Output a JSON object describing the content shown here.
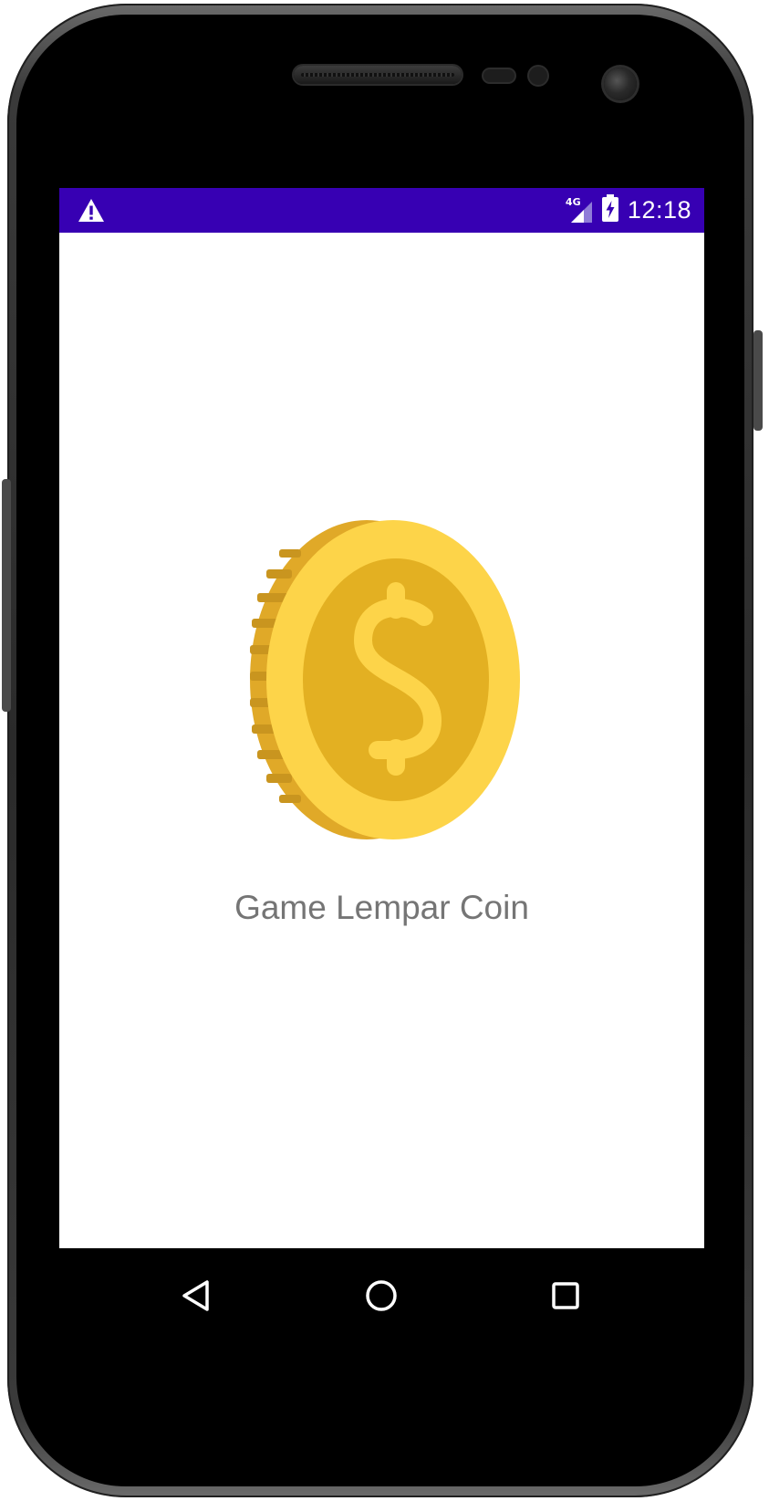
{
  "status_bar": {
    "network_type": "4G",
    "time": "12:18",
    "background_color": "#3700b3",
    "icons": [
      "warning-icon",
      "signal-icon",
      "battery-charging-icon"
    ]
  },
  "main": {
    "title": "Game Lempar Coin",
    "image": "coin-dollar-icon"
  },
  "navigation_bar": {
    "icons": [
      "back-icon",
      "home-icon",
      "recents-icon"
    ]
  },
  "colors": {
    "coin_face": "#e3b022",
    "coin_rim": "#fdd449",
    "coin_edge": "#e0a928",
    "title_text": "#757575"
  }
}
